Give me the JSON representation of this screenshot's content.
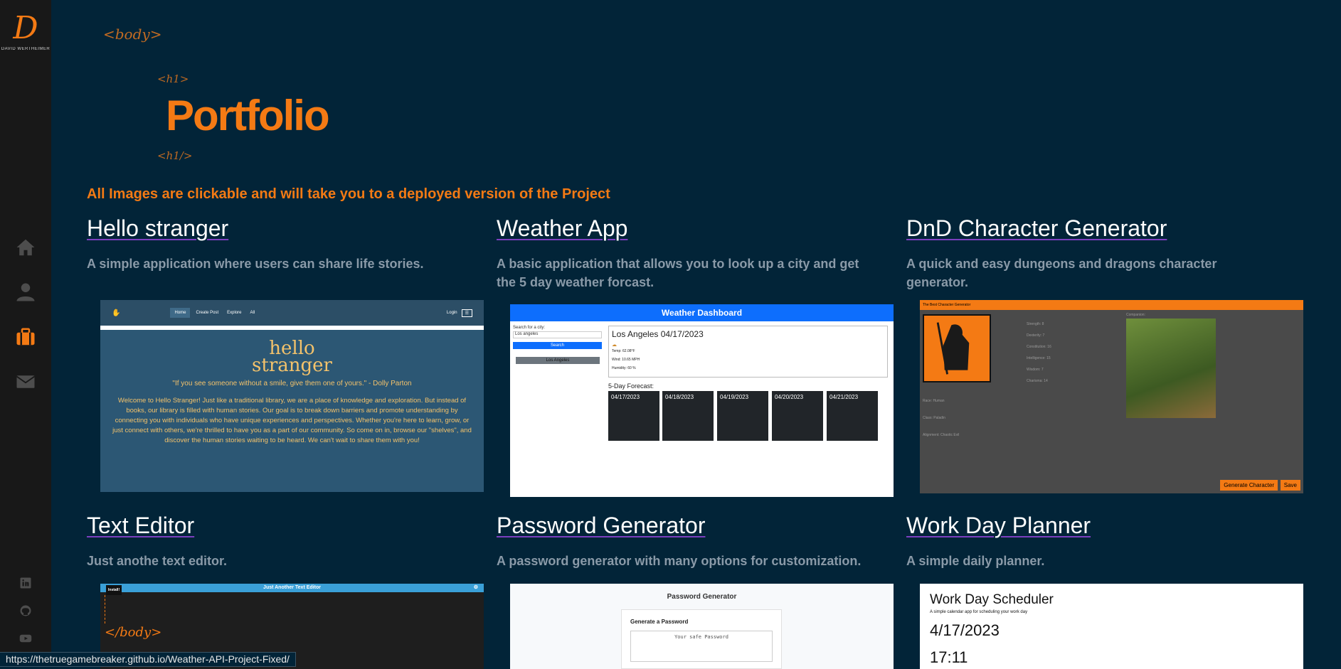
{
  "sidebar": {
    "logo_letter": "D",
    "logo_sub": "DAVID WERTHEIMER",
    "nav": [
      "home-icon",
      "user-icon",
      "briefcase-icon",
      "envelope-icon"
    ],
    "social": [
      "linkedin-icon",
      "github-icon",
      "youtube-icon"
    ],
    "colors": {
      "active": "#f47a14",
      "inactive": "#4d4d4d",
      "social": "#4d4d4d"
    }
  },
  "tags": {
    "body_open": "<body>",
    "h1_open": "<h1>",
    "h1_close": "<h1/>"
  },
  "header": {
    "title": "Portfolio"
  },
  "notice": "All Images are clickable and will take you to a deployed version of the Project",
  "projects": [
    {
      "title": "Hello stranger",
      "desc": "A simple application where users can share life stories."
    },
    {
      "title": "Weather App",
      "desc": "A basic application that allows you to look up a city and get the 5 day weather forcast."
    },
    {
      "title": "DnD Character Generator",
      "desc": "A quick and easy dungeons and dragons character generator."
    },
    {
      "title": "Text Editor",
      "desc": "Just anothe text editor."
    },
    {
      "title": "Password Generator",
      "desc": "A password generator with many options for customization."
    },
    {
      "title": "Work Day Planner",
      "desc": "A simple daily planner."
    }
  ],
  "hello": {
    "nav": [
      "Home",
      "Create Post",
      "Explore",
      "All"
    ],
    "login": "Login",
    "logo_line1": "hello",
    "logo_line2": "stranger",
    "quote": "\"If you see someone without a smile, give them one of yours.\" - Dolly Parton",
    "text": "Welcome to Hello Stranger! Just like a traditional library, we are a place of knowledge and exploration. But instead of books, our library is filled with human stories. Our goal is to break down barriers and promote understanding by connecting you with individuals who have unique experiences and perspectives. Whether you're here to learn, grow, or just connect with others, we're thrilled to have you as a part of our community. So come on in, browse our \"shelves\", and discover the human stories waiting to be heard. We can't wait to share them with you!"
  },
  "weather": {
    "header": "Weather Dashboard",
    "search_label": "Search for a city:",
    "search_value": "Los angeles",
    "search_btn": "Search",
    "history_btn": "Los Angeles",
    "city_date": "Los Angeles 04/17/2023",
    "temp": "Temp: 62.08°F",
    "wind": "Wind: 10.65 MPH",
    "humidity": "Humidity: 60 %",
    "forecast_label": "5-Day Forecast:",
    "days": [
      "04/17/2023",
      "04/18/2023",
      "04/19/2023",
      "04/20/2023",
      "04/21/2023"
    ]
  },
  "dnd": {
    "header": "The Best Character Generator",
    "stats": [
      "Strength: 8",
      "Dexterity: 7",
      "Constitution: 16",
      "Intelligence: 15",
      "Wisdom: 7",
      "Charisma: 14"
    ],
    "companion": "Companion:",
    "fields": [
      "Race: Human",
      "Class: Paladin",
      "Alignment: Chaotic Evil"
    ],
    "generate": "Generate Character",
    "save": "Save"
  },
  "editor": {
    "header": "Just Another Text Editor",
    "install": "Install!",
    "tag": "</body>"
  },
  "password": {
    "title": "Password Generator",
    "label": "Generate a Password",
    "placeholder": "Your safe Password"
  },
  "planner": {
    "title": "Work Day Scheduler",
    "sub": "A simple calendar app for scheduling your work day",
    "date": "4/17/2023",
    "time": "17:11"
  },
  "status_url": "https://thetruegamebreaker.github.io/Weather-API-Project-Fixed/"
}
